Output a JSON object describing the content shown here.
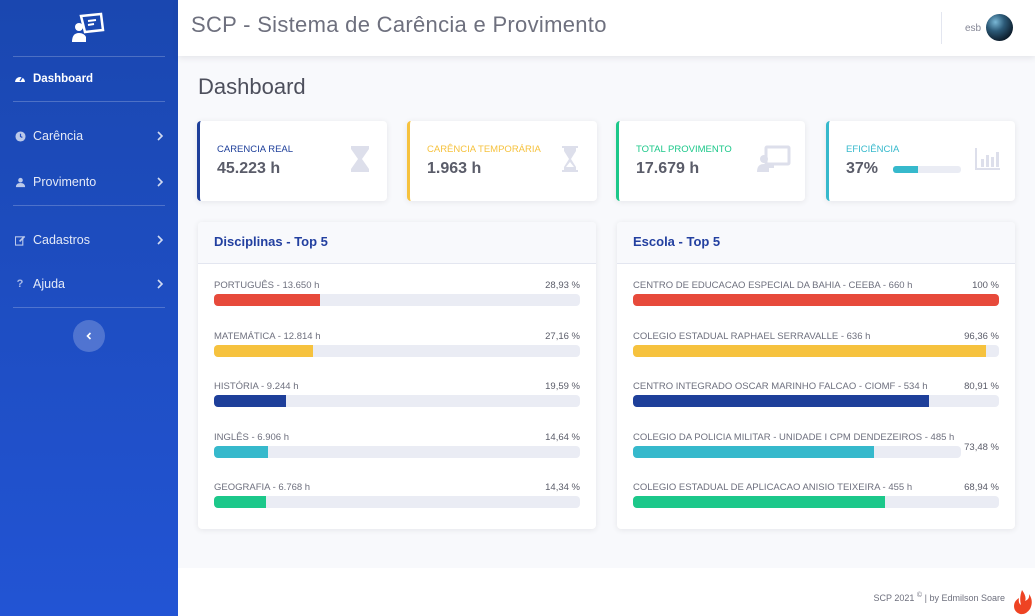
{
  "app": {
    "title": "SCP - Sistema de Carência e Provimento"
  },
  "user": {
    "name": "esb"
  },
  "sidebar": {
    "items": [
      {
        "label": "Dashboard",
        "icon": "tachometer-icon",
        "active": true
      },
      {
        "label": "Carência",
        "icon": "clock-icon"
      },
      {
        "label": "Provimento",
        "icon": "user-icon"
      },
      {
        "label": "Cadastros",
        "icon": "edit-icon"
      },
      {
        "label": "Ajuda",
        "icon": "question-icon"
      }
    ],
    "toggle_icon": "chevron-left-icon"
  },
  "page": {
    "title": "Dashboard"
  },
  "cards": [
    {
      "title": "CARENCIA REAL",
      "value": "45.223 h",
      "icon": "hourglass-icon",
      "color": "#1e3f9a"
    },
    {
      "title": "CARÊNCIA TEMPORÁRIA",
      "value": "1.963 h",
      "icon": "hourglass-icon",
      "color": "#f6c23e"
    },
    {
      "title": "TOTAL PROVIMENTO",
      "value": "17.679 h",
      "icon": "chalkboard-teacher-icon",
      "color": "#1cc88a"
    },
    {
      "title": "EFICIÊNCIA",
      "value": "37%",
      "icon": "bar-chart-icon",
      "color": "#36b9cc",
      "progress": 37
    }
  ],
  "disciplinas": {
    "title": "Disciplinas - Top 5",
    "rows": [
      {
        "label": "PORTUGUÊS - 13.650 h",
        "percent_text": "28,93 %",
        "percent": 28.93,
        "color": "#e74a3b"
      },
      {
        "label": "MATEMÁTICA - 12.814 h",
        "percent_text": "27,16 %",
        "percent": 27.16,
        "color": "#f6c23e"
      },
      {
        "label": "HISTÓRIA - 9.244 h",
        "percent_text": "19,59 %",
        "percent": 19.59,
        "color": "#1e3f9a"
      },
      {
        "label": "INGLÊS - 6.906 h",
        "percent_text": "14,64 %",
        "percent": 14.64,
        "color": "#36b9cc"
      },
      {
        "label": "GEOGRAFIA - 6.768 h",
        "percent_text": "14,34 %",
        "percent": 14.34,
        "color": "#1cc88a"
      }
    ]
  },
  "escolas": {
    "title": "Escola - Top 5",
    "rows": [
      {
        "label": "CENTRO DE EDUCACAO ESPECIAL DA BAHIA - CEEBA - 660 h",
        "percent_text": "100 %",
        "percent": 100,
        "color": "#e74a3b"
      },
      {
        "label": "COLEGIO ESTADUAL RAPHAEL SERRAVALLE - 636 h",
        "percent_text": "96,36 %",
        "percent": 96.36,
        "color": "#f6c23e"
      },
      {
        "label": "CENTRO INTEGRADO OSCAR MARINHO FALCAO - CIOMF - 534 h",
        "percent_text": "80,91 %",
        "percent": 80.91,
        "color": "#1e3f9a"
      },
      {
        "label": "COLEGIO DA POLICIA MILITAR - UNIDADE I CPM DENDEZEIROS - 485 h",
        "percent_text": "73,48 %",
        "percent": 73.48,
        "color": "#36b9cc",
        "wrap": true
      },
      {
        "label": "COLEGIO ESTADUAL DE APLICACAO ANISIO TEIXEIRA - 455 h",
        "percent_text": "68,94 %",
        "percent": 68.94,
        "color": "#1cc88a"
      }
    ]
  },
  "footer": {
    "text": "SCP 2021",
    "copyright": "©",
    "author": " |  by Edmilson Soare"
  }
}
